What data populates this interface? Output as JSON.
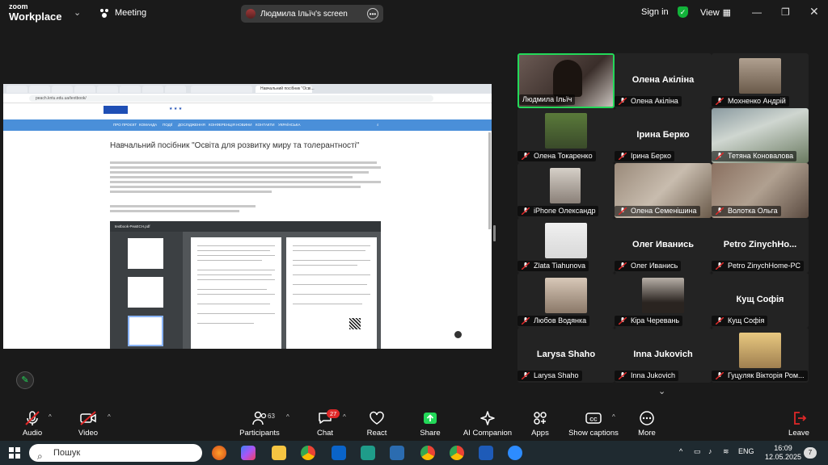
{
  "topbar": {
    "logo_line1": "zoom",
    "logo_line2": "Workplace",
    "meeting_label": "Meeting",
    "share_label": "Людмила Ільїч's screen",
    "sign_in": "Sign in",
    "view": "View"
  },
  "shared_screen": {
    "tab_title": "Навчальний посібник \"Осві...",
    "url": "peach.kntu.edu.ua/textbook/",
    "nav_items": [
      "ПРО ПРОЄКТ",
      "КОМАНДА",
      "ПОДІЇ",
      "ДОСЛІДЖЕННЯ",
      "КОНФЕРЕНЦІЯ",
      "НОВИНИ",
      "КОНТАКТИ",
      "УКРАЇНСЬКА"
    ],
    "page_title": "Навчальний посібник \"Освіта для розвитку миру та толерантності\"",
    "pdf_name": "textbook-PeaECH.pdf"
  },
  "gallery": {
    "tiles": [
      {
        "name": "Людмила Ільїч",
        "type": "video",
        "speaking": true
      },
      {
        "name": "Олена Акіліна",
        "big": "Олена Акіліна",
        "type": "name"
      },
      {
        "name": "Мохненко Андрій",
        "type": "photo"
      },
      {
        "name": "Олена Токаренко",
        "type": "photo"
      },
      {
        "name": "Ірина Берко",
        "big": "Ірина Берко",
        "type": "name"
      },
      {
        "name": "Тетяна Коновалова",
        "type": "video"
      },
      {
        "name": "iPhone Олександр",
        "type": "photo"
      },
      {
        "name": "Олена Семенішина",
        "type": "video"
      },
      {
        "name": "Волотка Ольга",
        "type": "video"
      },
      {
        "name": "Zlata Tiahunova",
        "type": "photo"
      },
      {
        "name": "Олег Иванись",
        "big": "Олег Иванись",
        "type": "name"
      },
      {
        "name": "Petro ZinychHome-PC",
        "big": "Petro ZinychHo...",
        "type": "name"
      },
      {
        "name": "Любов Водянка",
        "type": "photo"
      },
      {
        "name": "Кіра Черевань",
        "type": "photo"
      },
      {
        "name": "Кущ Софія",
        "big": "Кущ Софія",
        "type": "name"
      },
      {
        "name": "Larysa Shaho",
        "big": "Larysa Shaho",
        "type": "name"
      },
      {
        "name": "Inna Jukovich",
        "big": "Inna Jukovich",
        "type": "name"
      },
      {
        "name": "Гуцуляк Вікторія Ром...",
        "type": "photo"
      }
    ]
  },
  "toolbar": {
    "audio": "Audio",
    "video": "Video",
    "participants": "Participants",
    "participants_count": "63",
    "chat": "Chat",
    "chat_badge": "27",
    "react": "React",
    "share": "Share",
    "ai_companion": "AI Companion",
    "apps": "Apps",
    "show_captions": "Show captions",
    "more": "More",
    "leave": "Leave"
  },
  "taskbar": {
    "search_placeholder": "Пошук",
    "lang": "ENG",
    "time": "16:09",
    "date": "12.05.2025",
    "notifications": "7"
  },
  "colors": {
    "accent_green": "#23d959",
    "leave_red": "#e02828",
    "site_nav_blue": "#4a8fd9"
  }
}
